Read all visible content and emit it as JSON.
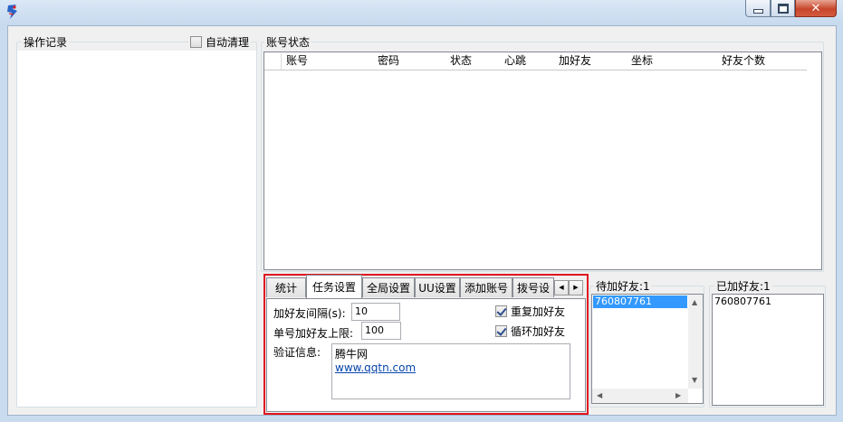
{
  "window": {
    "title_icon": "app-logo-icon",
    "minimize_glyph": "▁",
    "maximize_glyph": "□",
    "close_glyph": "✕"
  },
  "operation_log": {
    "title": "操作记录",
    "auto_clear_label": "自动清理",
    "auto_clear_checked": false
  },
  "account_status": {
    "title": "账号状态",
    "columns": [
      "账号",
      "密码",
      "状态",
      "心跳",
      "加好友",
      "坐标",
      "好友个数"
    ]
  },
  "tabs": {
    "items": [
      "统计",
      "任务设置",
      "全局设置",
      "UU设置",
      "添加账号",
      "拨号设"
    ],
    "active": "任务设置",
    "scroll_left": "◀",
    "scroll_right": "▶"
  },
  "task_settings": {
    "interval_label": "加好友间隔(s):",
    "interval_value": "10",
    "limit_label": "单号加好友上限:",
    "limit_value": "100",
    "repeat_label": "重复加好友",
    "repeat_checked": true,
    "loop_label": "循环加好友",
    "loop_checked": true,
    "verify_label": "验证信息:",
    "verify_line1": "腾牛网",
    "verify_link": "www.qqtn.com"
  },
  "pending": {
    "title": "待加好友:1",
    "items": [
      "760807761"
    ]
  },
  "added": {
    "title": "已加好友:1",
    "items": [
      "760807761"
    ]
  },
  "colors": {
    "highlight_border": "#e0141e",
    "selection": "#3399ff",
    "link": "#0645ad"
  }
}
